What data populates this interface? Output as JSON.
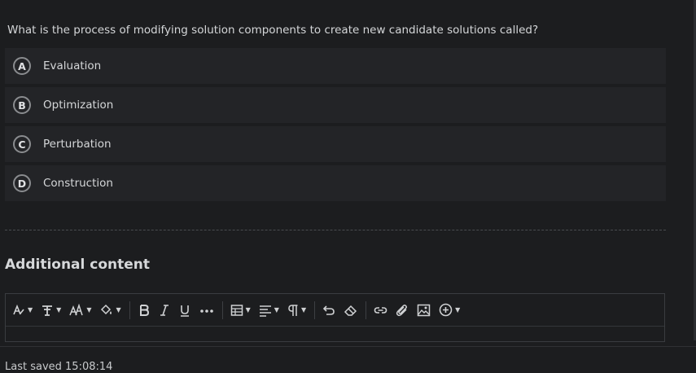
{
  "question": {
    "text": "What is the process of modifying solution components to create new candidate solutions called?",
    "options": [
      {
        "letter": "A",
        "label": "Evaluation"
      },
      {
        "letter": "B",
        "label": "Optimization"
      },
      {
        "letter": "C",
        "label": "Perturbation"
      },
      {
        "letter": "D",
        "label": "Construction"
      }
    ]
  },
  "additional": {
    "title": "Additional content"
  },
  "toolbar": {
    "icons": [
      "text-style-icon",
      "font-family-icon",
      "font-size-icon",
      "highlight-icon",
      "bold-icon",
      "italic-icon",
      "underline-icon",
      "more-icon",
      "table-icon",
      "align-icon",
      "paragraph-icon",
      "undo-icon",
      "eraser-icon",
      "link-icon",
      "attachment-icon",
      "image-icon",
      "insert-icon"
    ]
  },
  "footer": {
    "saved_text": "Last saved 15:08:14"
  }
}
